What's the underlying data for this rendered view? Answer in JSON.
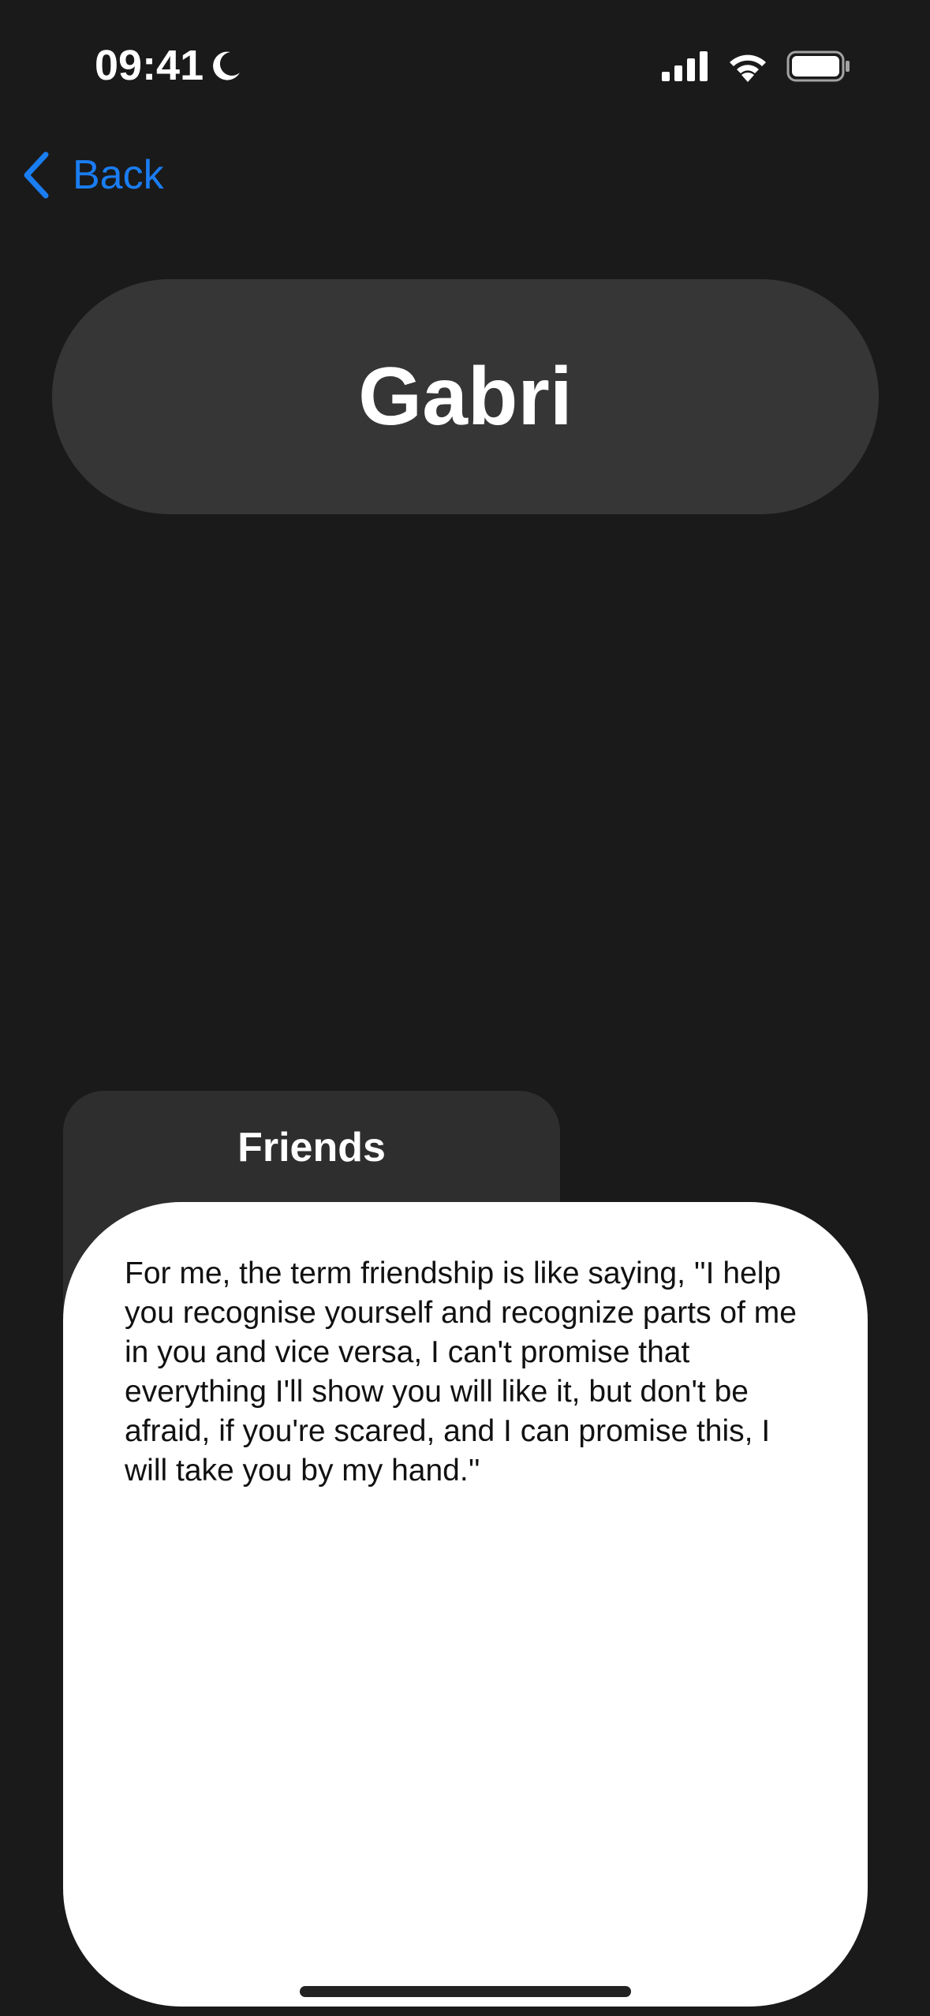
{
  "status_bar": {
    "time": "09:41",
    "focus_icon": "moon-icon",
    "signal_icon": "cellular-signal-icon",
    "wifi_icon": "wifi-icon",
    "battery_icon": "battery-icon"
  },
  "nav": {
    "back_label": "Back",
    "back_icon": "chevron-left-icon",
    "accent_color": "#1a7df2"
  },
  "header": {
    "name": "Gabri"
  },
  "card": {
    "title": "Friends"
  },
  "sheet": {
    "text": "For me, the term friendship is like saying, ''I help you recognise yourself and recognize parts of me in you and vice versa, I can't promise that everything I'll show you will like it, but don't be afraid, if you're scared, and I can promise this, I will take you by my hand.''"
  },
  "colors": {
    "background": "#1a1a1a",
    "pill": "#363636",
    "card": "#2e2e2e",
    "sheet": "#ffffff"
  }
}
